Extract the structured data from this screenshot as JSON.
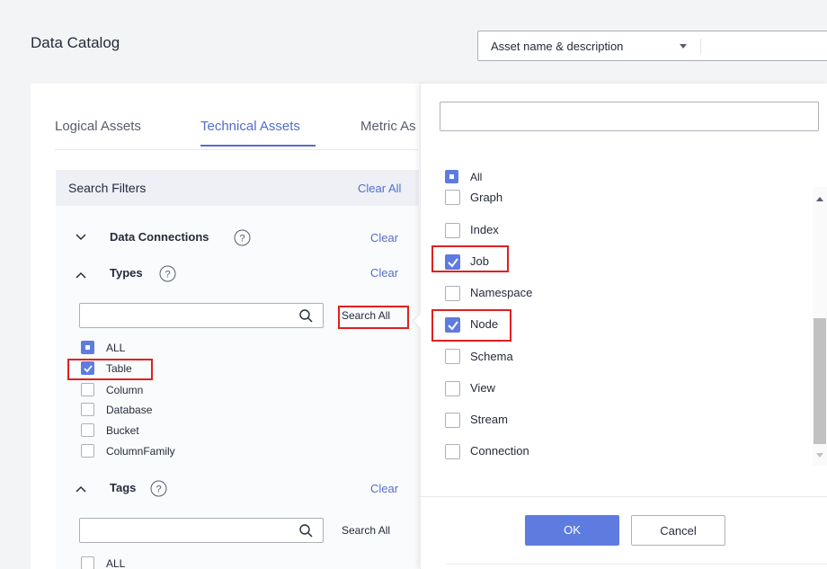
{
  "header": {
    "title": "Data Catalog",
    "search_mode": "Asset name & description"
  },
  "tabs": [
    {
      "label": "Logical Assets"
    },
    {
      "label": "Technical Assets",
      "active": true
    },
    {
      "label": "Metric As"
    }
  ],
  "filters": {
    "title": "Search Filters",
    "clear_all": "Clear All",
    "sections": {
      "data_connections": {
        "label": "Data Connections",
        "clear": "Clear"
      },
      "types": {
        "label": "Types",
        "clear": "Clear",
        "search_all": "Search All",
        "options": [
          {
            "label": "ALL",
            "state": "partial"
          },
          {
            "label": "Table",
            "state": "checked"
          },
          {
            "label": "Column",
            "state": "unchecked"
          },
          {
            "label": "Database",
            "state": "unchecked"
          },
          {
            "label": "Bucket",
            "state": "unchecked"
          },
          {
            "label": "ColumnFamily",
            "state": "unchecked"
          }
        ]
      },
      "tags": {
        "label": "Tags",
        "clear": "Clear",
        "search_all": "Search All",
        "options": [
          {
            "label": "ALL",
            "state": "unchecked"
          }
        ]
      }
    }
  },
  "popup": {
    "search_value": "",
    "options": [
      {
        "label": "All",
        "state": "partial"
      },
      {
        "label": "Graph",
        "state": "unchecked"
      },
      {
        "label": "Index",
        "state": "unchecked"
      },
      {
        "label": "Job",
        "state": "checked"
      },
      {
        "label": "Namespace",
        "state": "unchecked"
      },
      {
        "label": "Node",
        "state": "checked"
      },
      {
        "label": "Schema",
        "state": "unchecked"
      },
      {
        "label": "View",
        "state": "unchecked"
      },
      {
        "label": "Stream",
        "state": "unchecked"
      },
      {
        "label": "Connection",
        "state": "unchecked"
      }
    ],
    "ok_label": "OK",
    "cancel_label": "Cancel"
  },
  "colors": {
    "accent": "#5e7ce0",
    "highlight": "#e02020",
    "link": "#526ecc"
  }
}
